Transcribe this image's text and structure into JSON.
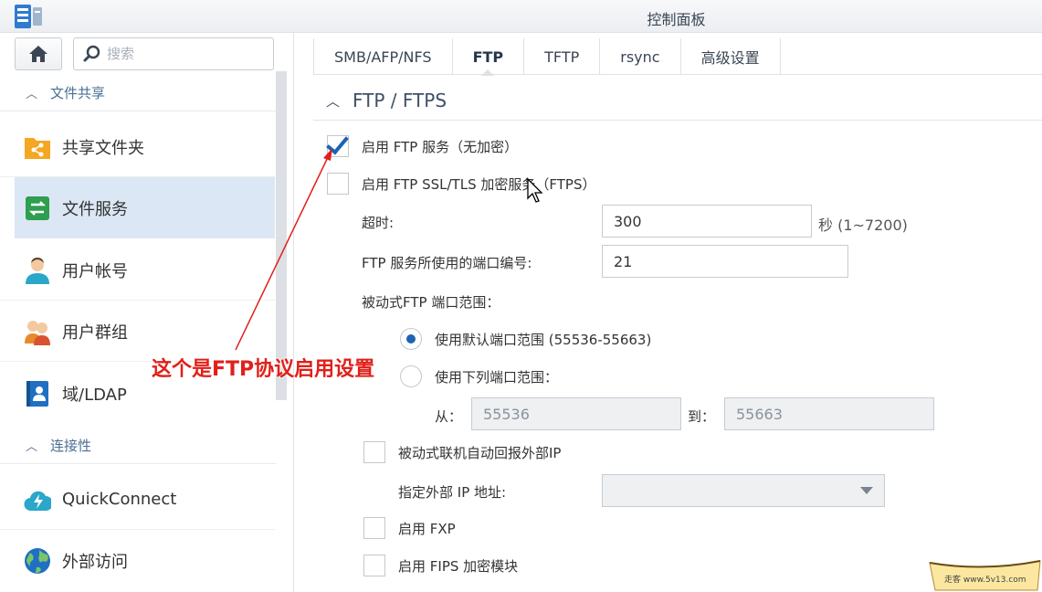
{
  "window": {
    "title": "控制面板"
  },
  "sidebar": {
    "search_placeholder": "搜索",
    "sections": [
      {
        "label": "文件共享"
      },
      {
        "label": "连接性"
      }
    ],
    "items": [
      {
        "label": "共享文件夹",
        "icon": "shared-folder-icon"
      },
      {
        "label": "文件服务",
        "icon": "file-services-icon"
      },
      {
        "label": "用户帐号",
        "icon": "user-icon"
      },
      {
        "label": "用户群组",
        "icon": "group-icon"
      },
      {
        "label": "域/LDAP",
        "icon": "domain-ldap-icon"
      },
      {
        "label": "QuickConnect",
        "icon": "quickconnect-icon"
      },
      {
        "label": "外部访问",
        "icon": "globe-icon"
      }
    ]
  },
  "tabs": [
    {
      "label": "SMB/AFP/NFS"
    },
    {
      "label": "FTP"
    },
    {
      "label": "TFTP"
    },
    {
      "label": "rsync"
    },
    {
      "label": "高级设置"
    }
  ],
  "ftp": {
    "group_title": "FTP / FTPS",
    "enable_ftp": {
      "label": "启用 FTP 服务（无加密）",
      "checked": true
    },
    "enable_ftps": {
      "label": "启用 FTP SSL/TLS 加密服务（FTPS）",
      "checked": false
    },
    "timeout": {
      "label": "超时:",
      "value": "300",
      "suffix": "秒 (1~7200)"
    },
    "port": {
      "label": "FTP 服务所使用的端口编号:",
      "value": "21"
    },
    "passive_range_label": "被动式FTP 端口范围：",
    "default_range": {
      "label": "使用默认端口范围 (55536-55663)",
      "selected": true
    },
    "custom_range": {
      "label": "使用下列端口范围：",
      "selected": false
    },
    "from": {
      "label": "从：",
      "value": "55536"
    },
    "to": {
      "label": "到：",
      "value": "55663"
    },
    "report_external_ip": {
      "label": "被动式联机自动回报外部IP",
      "checked": false
    },
    "external_ip": {
      "label": "指定外部 IP 地址:",
      "value": ""
    },
    "enable_fxp": {
      "label": "启用 FXP",
      "checked": false
    },
    "enable_fips": {
      "label": "启用 FIPS 加密模块",
      "checked": false
    }
  },
  "annotation": {
    "text": "这个是FTP协议启用设置",
    "color": "#e0201a"
  },
  "watermark": {
    "text": "走客 www.5v13.com"
  },
  "colors": {
    "accent": "#1c63b4",
    "active_nav": "#dbe7f4",
    "section_text": "#4a6e93"
  }
}
